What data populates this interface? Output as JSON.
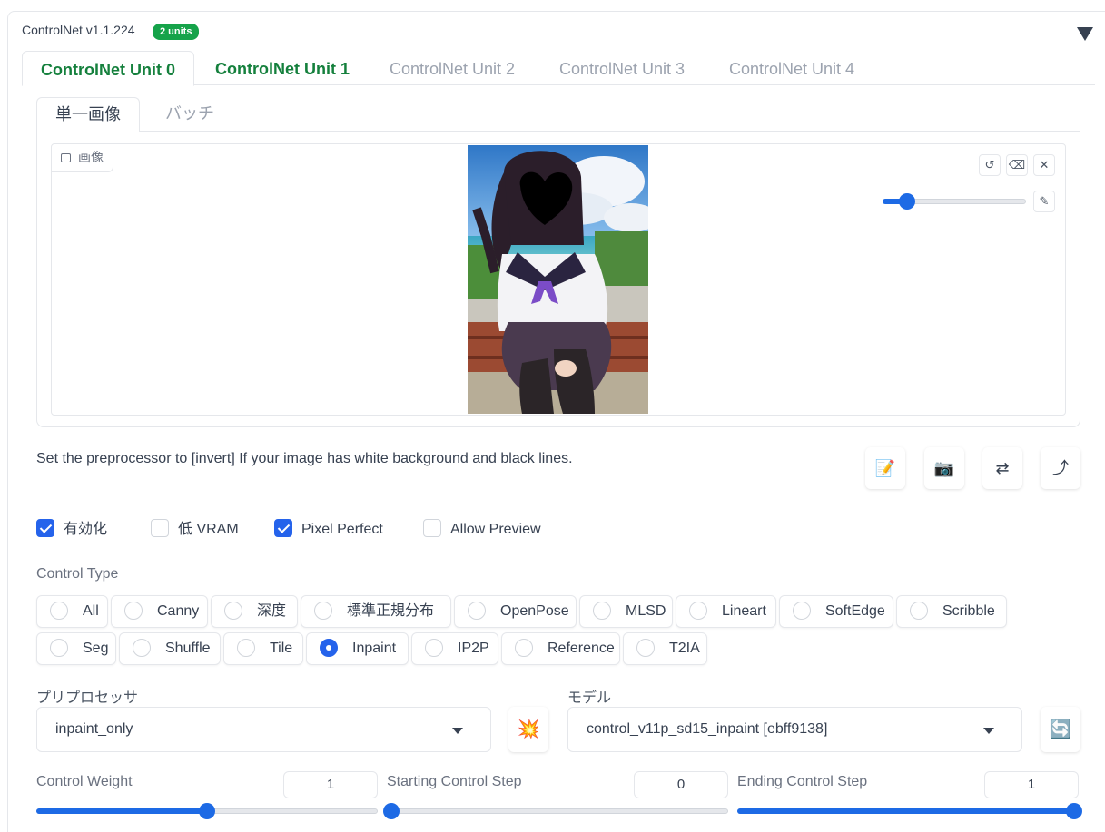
{
  "header": {
    "title": "ControlNet v1.1.224",
    "badge": "2 units"
  },
  "unit_tabs": [
    "ControlNet Unit 0",
    "ControlNet Unit 1",
    "ControlNet Unit 2",
    "ControlNet Unit 3",
    "ControlNet Unit 4"
  ],
  "sub_tabs": [
    "単一画像",
    "バッチ"
  ],
  "image_panel": {
    "label": "画像",
    "brush_size_fraction": 0.17
  },
  "hint_text": "Set the preprocessor to [invert] If your image has white background and black lines.",
  "tools": {
    "edit": "📝",
    "camera": "📷",
    "swap": "⇄",
    "send": "⤴"
  },
  "checkboxes": [
    {
      "label": "有効化",
      "checked": true
    },
    {
      "label": "低 VRAM",
      "checked": false
    },
    {
      "label": "Pixel Perfect",
      "checked": true
    },
    {
      "label": "Allow Preview",
      "checked": false
    }
  ],
  "control_type": {
    "label": "Control Type",
    "options": [
      "All",
      "Canny",
      "深度",
      "標準正規分布",
      "OpenPose",
      "MLSD",
      "Lineart",
      "SoftEdge",
      "Scribble",
      "Seg",
      "Shuffle",
      "Tile",
      "Inpaint",
      "IP2P",
      "Reference",
      "T2IA"
    ],
    "selected": "Inpaint"
  },
  "preprocessor": {
    "label": "プリプロセッサ",
    "value": "inpaint_only",
    "run_icon": "💥"
  },
  "model": {
    "label": "モデル",
    "value": "control_v11p_sd15_inpaint [ebff9138]",
    "refresh_icon": "🔄"
  },
  "sliders": [
    {
      "label": "Control Weight",
      "value": "1",
      "fraction": 0.5
    },
    {
      "label": "Starting Control Step",
      "value": "0",
      "fraction": 0.0
    },
    {
      "label": "Ending Control Step",
      "value": "1",
      "fraction": 1.0
    }
  ],
  "colors": {
    "accent": "#2563eb",
    "tab_active": "#15803d",
    "badge": "#16a34a"
  }
}
